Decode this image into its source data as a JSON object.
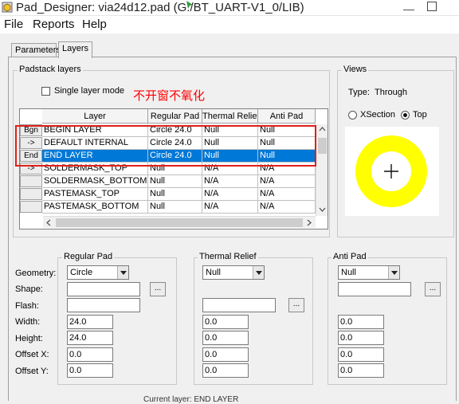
{
  "window": {
    "title": "Pad_Designer: via24d12.pad (G:/BT_UART-V1_0/LIB)",
    "minimize_label": "—"
  },
  "menu": [
    "File",
    "Reports",
    "Help"
  ],
  "tabs": [
    {
      "label": "Parameters",
      "active": false
    },
    {
      "label": "Layers",
      "active": true
    }
  ],
  "padstack": {
    "group_title": "Padstack layers",
    "single_layer_label": "Single layer mode",
    "annotation": "不开窗不氧化",
    "columns": [
      "Layer",
      "Regular Pad",
      "Thermal Relief",
      "Anti Pad"
    ],
    "rows": [
      {
        "btn": "Bgn",
        "layer": "BEGIN LAYER",
        "regular": "Circle 24.0",
        "thermal": "Null",
        "anti": "Null",
        "selected": false
      },
      {
        "btn": "->",
        "layer": "DEFAULT INTERNAL",
        "regular": "Circle 24.0",
        "thermal": "Null",
        "anti": "Null",
        "selected": false
      },
      {
        "btn": "End",
        "layer": "END LAYER",
        "regular": "Circle 24.0",
        "thermal": "Null",
        "anti": "Null",
        "selected": true
      },
      {
        "btn": "->",
        "layer": "SOLDERMASK_TOP",
        "regular": "Null",
        "thermal": "N/A",
        "anti": "N/A",
        "selected": false
      },
      {
        "btn": "",
        "layer": "SOLDERMASK_BOTTOM",
        "regular": "Null",
        "thermal": "N/A",
        "anti": "N/A",
        "selected": false
      },
      {
        "btn": "",
        "layer": "PASTEMASK_TOP",
        "regular": "Null",
        "thermal": "N/A",
        "anti": "N/A",
        "selected": false
      },
      {
        "btn": "",
        "layer": "PASTEMASK_BOTTOM",
        "regular": "Null",
        "thermal": "N/A",
        "anti": "N/A",
        "selected": false
      }
    ]
  },
  "views": {
    "group_title": "Views",
    "type_label": "Type:",
    "type_value": "Through",
    "xsection_label": "XSection",
    "top_label": "Top",
    "selected_view": "Top",
    "pad_color": "#ffff00"
  },
  "field_labels": {
    "geometry": "Geometry:",
    "shape": "Shape:",
    "flash": "Flash:",
    "width": "Width:",
    "height": "Height:",
    "offset_x": "Offset X:",
    "offset_y": "Offset Y:",
    "browse": "..."
  },
  "regular_pad": {
    "title": "Regular Pad",
    "geometry": "Circle",
    "shape": "",
    "flash": "",
    "width": "24.0",
    "height": "24.0",
    "offset_x": "0.0",
    "offset_y": "0.0"
  },
  "thermal_relief": {
    "title": "Thermal Relief",
    "geometry": "Null",
    "flash": "",
    "width": "0.0",
    "height": "0.0",
    "offset_x": "0.0",
    "offset_y": "0.0"
  },
  "anti_pad": {
    "title": "Anti Pad",
    "geometry": "Null",
    "shape": "",
    "width": "0.0",
    "height": "0.0",
    "offset_x": "0.0",
    "offset_y": "0.0"
  },
  "status_partial": "Current layer: END LAYER"
}
